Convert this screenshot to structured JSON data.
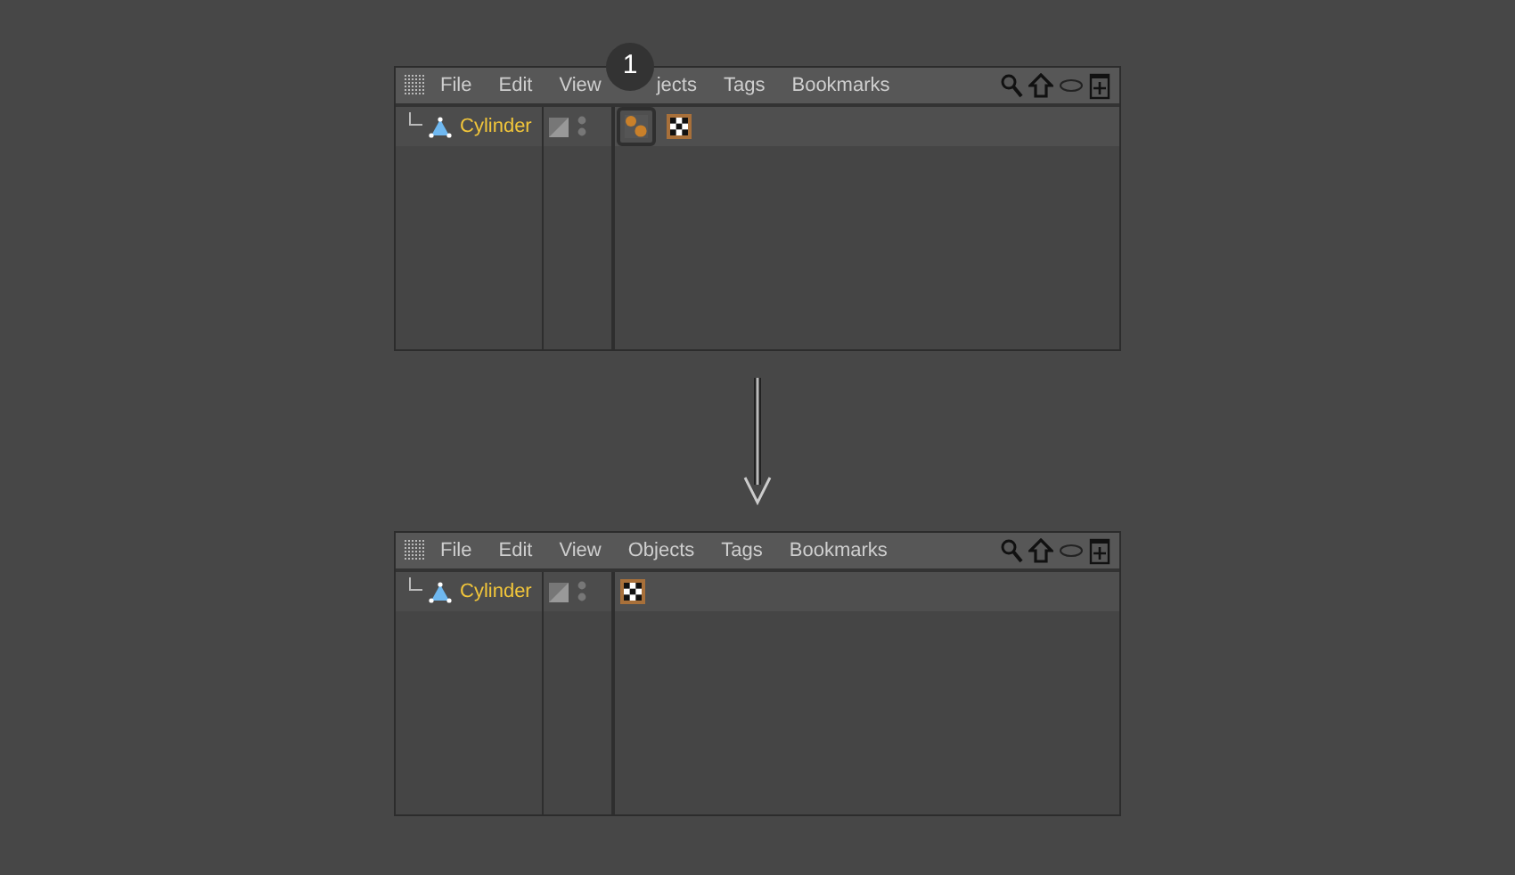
{
  "panels": [
    {
      "menu": [
        {
          "label": "File"
        },
        {
          "label": "Edit"
        },
        {
          "label": "View"
        },
        {
          "label": "jects",
          "covered": true
        },
        {
          "label": "Tags"
        },
        {
          "label": "Bookmarks"
        }
      ],
      "object": {
        "name": "Cylinder"
      },
      "tags": [
        {
          "kind": "material",
          "highlighted": true
        },
        {
          "kind": "texture",
          "highlighted": false
        }
      ],
      "badge": "1"
    },
    {
      "menu": [
        {
          "label": "File"
        },
        {
          "label": "Edit"
        },
        {
          "label": "View"
        },
        {
          "label": "Objects"
        },
        {
          "label": "Tags"
        },
        {
          "label": "Bookmarks"
        }
      ],
      "object": {
        "name": "Cylinder"
      },
      "tags": [
        {
          "kind": "texture",
          "highlighted": false
        }
      ]
    }
  ]
}
